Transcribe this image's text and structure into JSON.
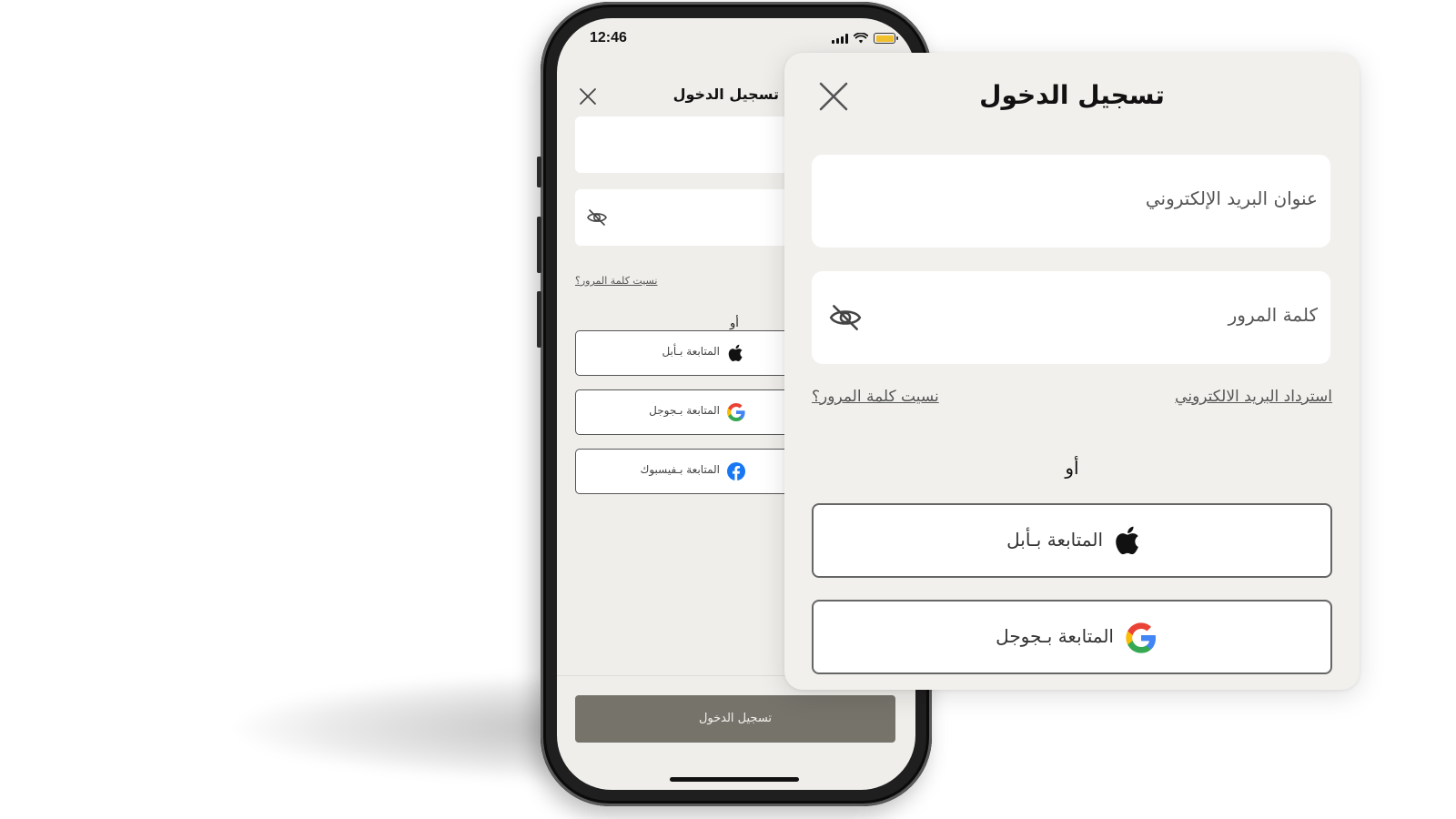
{
  "status_bar": {
    "time": "12:46"
  },
  "phone": {
    "title": "تسجيل الدخول",
    "forgot_password": "نسيت كلمة المرور؟",
    "or": "أو",
    "apple_button": "المتابعة بـأبل",
    "google_button": "المتابعة بـجوجل",
    "facebook_button": "المتابعة بـفيسبوك",
    "login_button": "تسجيل الدخول"
  },
  "card": {
    "title": "تسجيل الدخول",
    "email_placeholder": "عنوان البريد الإلكتروني",
    "password_placeholder": "كلمة المرور",
    "forgot_password": "نسيت كلمة المرور؟",
    "recover_email": "استرداد البريد الالكتروني",
    "or": "أو",
    "apple_button": "المتابعة بـأبل",
    "google_button": "المتابعة بـجوجل"
  },
  "icons": [
    "close-icon",
    "eye-off-icon",
    "apple-icon",
    "google-icon",
    "facebook-icon",
    "signal-icon",
    "wifi-icon",
    "battery-icon"
  ],
  "colors": {
    "background": "#f0eeeb",
    "field": "#ffffff",
    "login_button": "#75736a",
    "battery": "#f2c12e",
    "facebook": "#1877f2"
  }
}
